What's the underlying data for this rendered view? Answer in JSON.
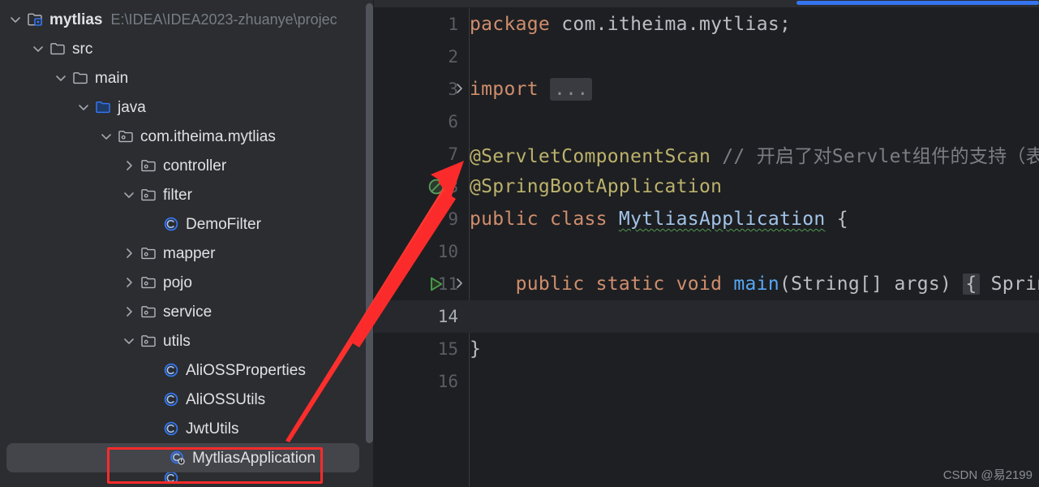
{
  "window": {
    "theme_bg": "#1e1f22",
    "sidebar_bg": "#2b2d30",
    "accent": "#3574f0",
    "annotation_color": "#fc2b2b"
  },
  "sidebar": {
    "items": [
      {
        "label": "mytlias",
        "path": "E:\\IDEA\\IDEA2023-zhuanye\\projec",
        "icon": "module-icon",
        "arrow": "chevron-down-icon",
        "indent": 0,
        "bold": true,
        "selected": false
      },
      {
        "label": "src",
        "path": "",
        "icon": "folder-icon",
        "arrow": "chevron-down-icon",
        "indent": 1,
        "bold": false,
        "selected": false
      },
      {
        "label": "main",
        "path": "",
        "icon": "folder-icon",
        "arrow": "chevron-down-icon",
        "indent": 2,
        "bold": false,
        "selected": false
      },
      {
        "label": "java",
        "path": "",
        "icon": "source-folder-icon",
        "arrow": "chevron-down-icon",
        "indent": 3,
        "bold": false,
        "selected": false
      },
      {
        "label": "com.itheima.mytlias",
        "path": "",
        "icon": "package-icon",
        "arrow": "chevron-down-icon",
        "indent": 4,
        "bold": false,
        "selected": false
      },
      {
        "label": "controller",
        "path": "",
        "icon": "package-icon",
        "arrow": "chevron-right-icon",
        "indent": 5,
        "bold": false,
        "selected": false
      },
      {
        "label": "filter",
        "path": "",
        "icon": "package-icon",
        "arrow": "chevron-down-icon",
        "indent": 5,
        "bold": false,
        "selected": false
      },
      {
        "label": "DemoFilter",
        "path": "",
        "icon": "java-class-icon",
        "arrow": "",
        "indent": 6,
        "bold": false,
        "selected": false
      },
      {
        "label": "mapper",
        "path": "",
        "icon": "package-icon",
        "arrow": "chevron-right-icon",
        "indent": 5,
        "bold": false,
        "selected": false
      },
      {
        "label": "pojo",
        "path": "",
        "icon": "package-icon",
        "arrow": "chevron-right-icon",
        "indent": 5,
        "bold": false,
        "selected": false
      },
      {
        "label": "service",
        "path": "",
        "icon": "package-icon",
        "arrow": "chevron-right-icon",
        "indent": 5,
        "bold": false,
        "selected": false
      },
      {
        "label": "utils",
        "path": "",
        "icon": "package-icon",
        "arrow": "chevron-down-icon",
        "indent": 5,
        "bold": false,
        "selected": false
      },
      {
        "label": "AliOSSProperties",
        "path": "",
        "icon": "java-class-icon",
        "arrow": "",
        "indent": 6,
        "bold": false,
        "selected": false
      },
      {
        "label": "AliOSSUtils",
        "path": "",
        "icon": "java-class-icon",
        "arrow": "",
        "indent": 6,
        "bold": false,
        "selected": false
      },
      {
        "label": "JwtUtils",
        "path": "",
        "icon": "java-class-icon",
        "arrow": "",
        "indent": 6,
        "bold": false,
        "selected": false
      },
      {
        "label": "MytliasApplication",
        "path": "",
        "icon": "spring-boot-class-icon",
        "arrow": "",
        "indent": 6,
        "bold": false,
        "selected": true
      }
    ]
  },
  "editor": {
    "lines": [
      {
        "num": "1",
        "gutter_icon": "",
        "fold": "",
        "caret": false,
        "tokens": [
          {
            "t": "kw",
            "v": "package "
          },
          {
            "t": "plain",
            "v": "com.itheima.mytlias;"
          }
        ]
      },
      {
        "num": "2",
        "gutter_icon": "",
        "fold": "",
        "caret": false,
        "tokens": []
      },
      {
        "num": "3",
        "gutter_icon": "",
        "fold": "chevron-right-icon",
        "caret": false,
        "tokens": [
          {
            "t": "kw",
            "v": "import "
          },
          {
            "t": "fold-box",
            "v": "..."
          }
        ]
      },
      {
        "num": "6",
        "gutter_icon": "",
        "fold": "",
        "caret": false,
        "tokens": []
      },
      {
        "num": "7",
        "gutter_icon": "",
        "fold": "",
        "caret": false,
        "tokens": [
          {
            "t": "ann",
            "v": "@ServletComponentScan "
          },
          {
            "t": "cmt",
            "v": "// 开启了对Servlet组件的支持（表示"
          }
        ]
      },
      {
        "num": "8",
        "gutter_icon": "spring-bean-icon",
        "fold": "",
        "caret": false,
        "tokens": [
          {
            "t": "ann",
            "v": "@SpringBootApplication"
          }
        ]
      },
      {
        "num": "9",
        "gutter_icon": "run-small-icon",
        "fold": "",
        "caret": false,
        "tokens": [
          {
            "t": "kw",
            "v": "public class "
          },
          {
            "t": "cls-squiggle",
            "v": "MytliasApplication"
          },
          {
            "t": "plain",
            "v": " {"
          }
        ]
      },
      {
        "num": "10",
        "gutter_icon": "",
        "fold": "",
        "caret": false,
        "tokens": []
      },
      {
        "num": "11",
        "gutter_icon": "run-icon",
        "fold": "chevron-right-icon",
        "caret": false,
        "tokens": [
          {
            "t": "kw",
            "v": "    public static void "
          },
          {
            "t": "mth",
            "v": "main"
          },
          {
            "t": "plain",
            "v": "(String[] args) "
          },
          {
            "t": "brace-fold",
            "v": "{"
          },
          {
            "t": "plain",
            "v": " Sprin"
          }
        ]
      },
      {
        "num": "14",
        "gutter_icon": "",
        "fold": "",
        "caret": true,
        "tokens": []
      },
      {
        "num": "15",
        "gutter_icon": "",
        "fold": "",
        "caret": false,
        "tokens": [
          {
            "t": "plain",
            "v": "}"
          }
        ]
      },
      {
        "num": "16",
        "gutter_icon": "",
        "fold": "",
        "caret": false,
        "tokens": []
      }
    ]
  },
  "annotations": {
    "arrow_label": "red-arrow-pointing-to-line-7",
    "highlight_label": "red-rectangle-around-mytlias-application"
  },
  "watermark": {
    "text": "CSDN @易2199"
  }
}
